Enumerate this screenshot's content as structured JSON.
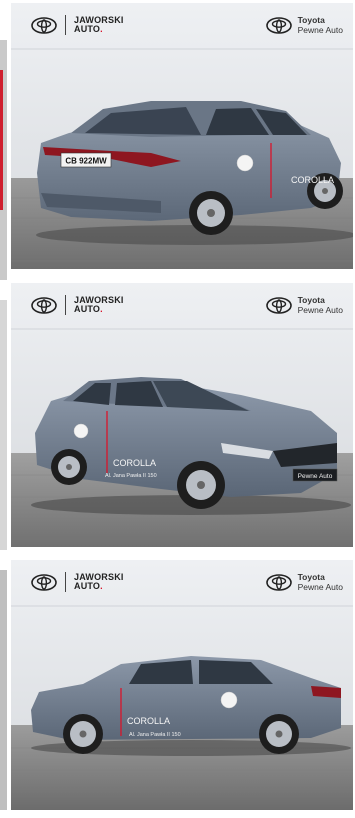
{
  "photos": [
    {
      "dealer_line1": "JAWORSKI",
      "dealer_line2": "AUTO",
      "dealer_dot": ".",
      "right_line1": "Toyota",
      "right_line2": "Pewne Auto",
      "model": "COROLLA",
      "plate": "CB 922MW"
    },
    {
      "dealer_line1": "JAWORSKI",
      "dealer_line2": "AUTO",
      "dealer_dot": ".",
      "right_line1": "Toyota",
      "right_line2": "Pewne Auto",
      "model": "COROLLA",
      "door_address": "Al. Jana Pawła II 150",
      "front_plate": "Pewne Auto"
    },
    {
      "dealer_line1": "JAWORSKI",
      "dealer_line2": "AUTO",
      "dealer_dot": ".",
      "right_line1": "Toyota",
      "right_line2": "Pewne Auto",
      "model": "COROLLA",
      "door_address": "Al. Jana Pawła II 150"
    }
  ],
  "colors": {
    "car_body": "#6f7c8e",
    "brand_red": "#d9142b",
    "wall": "#e9ebee",
    "ground": "#8a8a8a"
  },
  "icons": [
    "toyota-logo-icon"
  ]
}
